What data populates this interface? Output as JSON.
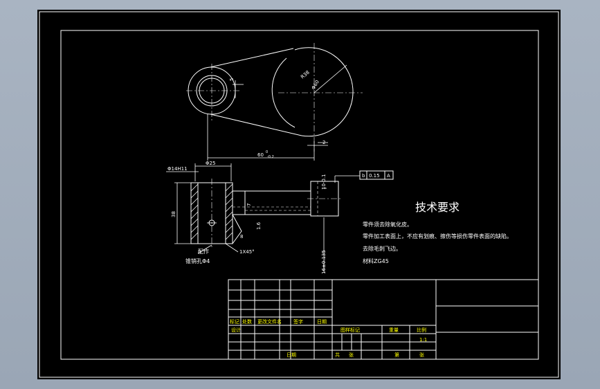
{
  "drawing": {
    "dimensions": {
      "r38": "R38",
      "d60": "Φ60",
      "five": "5",
      "two": "2",
      "sixty": "60",
      "sixty_tol_up": "0",
      "sixty_tol_dn": "-0.2",
      "d25": "Φ25",
      "d14h11": "Φ14H11",
      "h38": "38",
      "seven": "7",
      "one_six": "1.6",
      "eight": "8",
      "chamfer": "1X45°",
      "ten_tol": "10-0.1",
      "sixteen_tol": "16±0.135"
    },
    "gdt": {
      "symbol": "b",
      "value": "0.15",
      "datum": "A"
    },
    "notes": {
      "assemble": "配作",
      "pin_hole": "锥销孔Φ4"
    }
  },
  "tech_req": {
    "title": "技术要求",
    "lines": [
      "零件须去除氧化皮。",
      "零件加工表面上，不应有划痕、擦伤等损伤零件表面的缺陷。",
      "去除毛刺飞边。",
      "材料ZG45"
    ]
  },
  "title_block": {
    "rev_headers": [
      "标记",
      "处数",
      "更改文件名",
      "签字",
      "日期"
    ],
    "design": "设计",
    "date": "日期",
    "stage_headers": [
      "图样标记",
      "重量",
      "比例"
    ],
    "scale": "1:1",
    "sheets_total": "共",
    "sheets_unit": "张",
    "sheet_no": "第",
    "sheet_unit": "张"
  }
}
